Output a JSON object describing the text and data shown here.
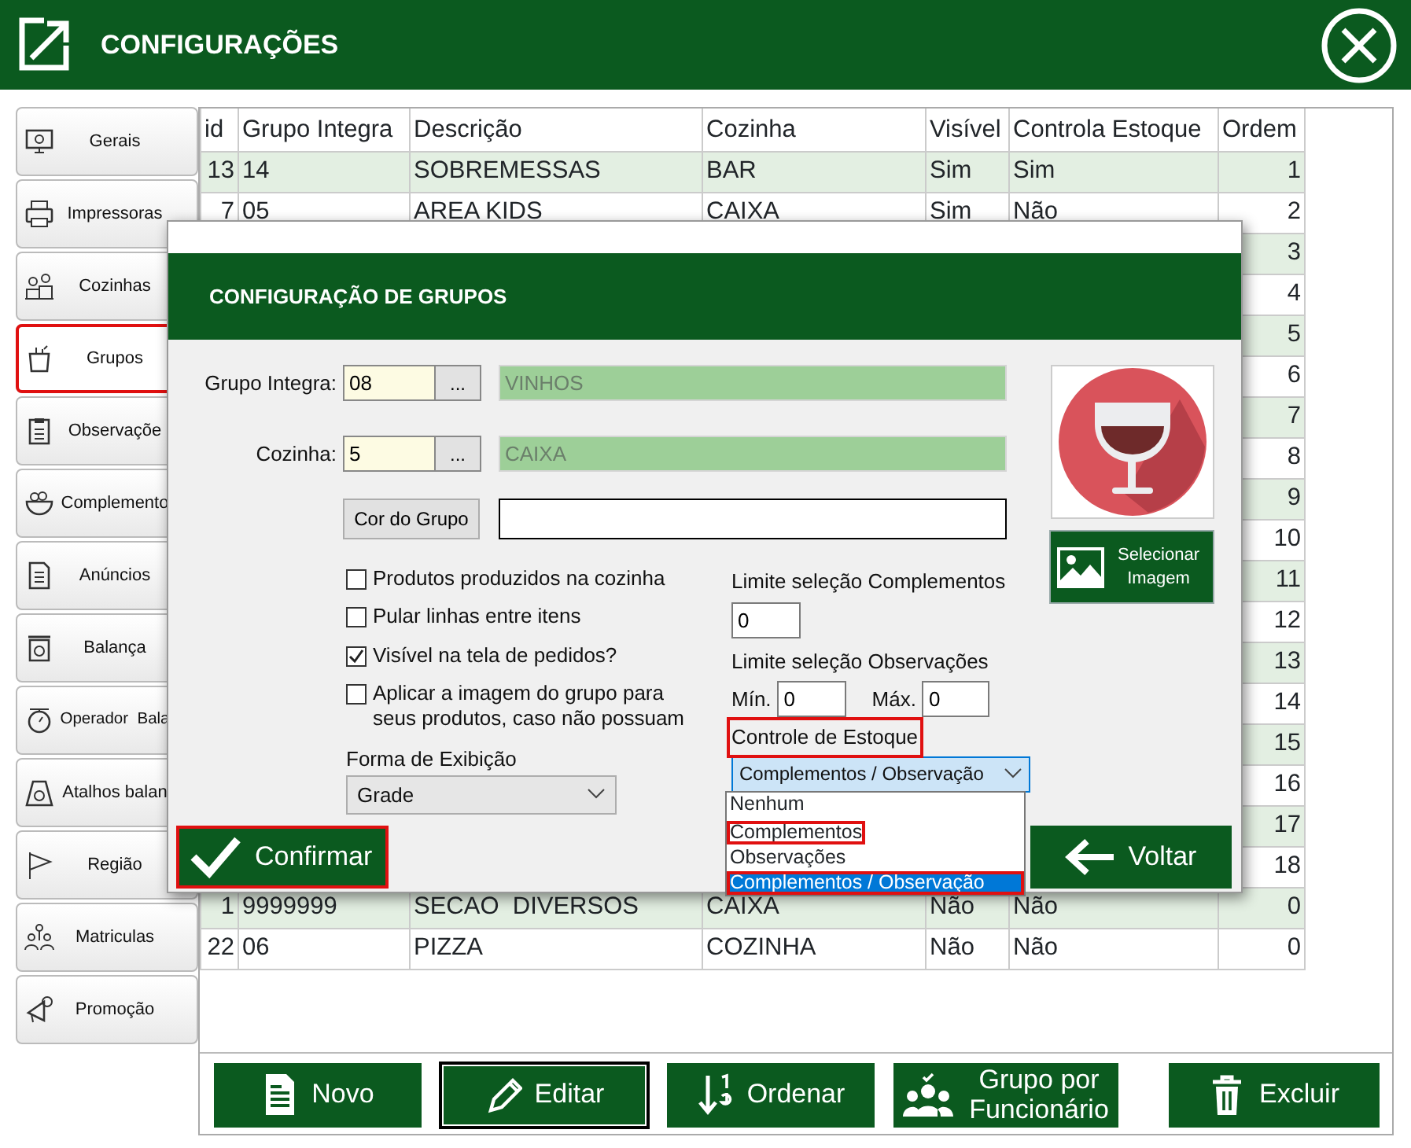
{
  "header": {
    "title": "CONFIGURAÇÕES"
  },
  "sidebar": {
    "items": [
      {
        "label": "Gerais",
        "selected": false,
        "highlighted": false
      },
      {
        "label": "Impressoras",
        "selected": false,
        "highlighted": false
      },
      {
        "label": "Cozinhas",
        "selected": false,
        "highlighted": false
      },
      {
        "label": "Grupos",
        "selected": true,
        "highlighted": true
      },
      {
        "label": "Observaçõe",
        "selected": false,
        "highlighted": false
      },
      {
        "label": "Complemento",
        "selected": false,
        "highlighted": false
      },
      {
        "label": "Anúncios",
        "selected": false,
        "highlighted": false
      },
      {
        "label": "Balança",
        "selected": false,
        "highlighted": false
      },
      {
        "label": "Operador  Bala",
        "selected": false,
        "highlighted": false
      },
      {
        "label": "Atalhos balan",
        "selected": false,
        "highlighted": false
      },
      {
        "label": "Região",
        "selected": false,
        "highlighted": false
      },
      {
        "label": "Matriculas",
        "selected": false,
        "highlighted": false
      },
      {
        "label": "Promoção",
        "selected": false,
        "highlighted": false
      }
    ]
  },
  "table": {
    "columns": [
      "id",
      "Grupo Integra",
      "Descrição",
      "Cozinha",
      "Visível",
      "Controla Estoque",
      "Ordem"
    ],
    "rows": [
      {
        "id": "13",
        "grupo": "14",
        "descricao": "SOBREMESSAS",
        "cozinha": "BAR",
        "visivel": "Sim",
        "controla": "Sim",
        "ordem": "1"
      },
      {
        "id": "7",
        "grupo": "05",
        "descricao": "AREA KIDS",
        "cozinha": "CAIXA",
        "visivel": "Sim",
        "controla": "Não",
        "ordem": "2"
      },
      {
        "ordem": "3"
      },
      {
        "ordem": "4"
      },
      {
        "ordem": "5"
      },
      {
        "ordem": "6"
      },
      {
        "ordem": "7"
      },
      {
        "ordem": "8"
      },
      {
        "ordem": "9"
      },
      {
        "ordem": "10"
      },
      {
        "ordem": "11"
      },
      {
        "ordem": "12"
      },
      {
        "ordem": "13"
      },
      {
        "ordem": "14"
      },
      {
        "ordem": "15"
      },
      {
        "ordem": "16"
      },
      {
        "ordem": "17"
      },
      {
        "ordem": "18"
      },
      {
        "id": "1",
        "grupo": "9999999",
        "descricao": "SECAO  DIVERSOS",
        "cozinha": "CAIXA",
        "visivel": "Não",
        "controla": "Não",
        "ordem": "0"
      },
      {
        "id": "22",
        "grupo": "06",
        "descricao": "PIZZA",
        "cozinha": "COZINHA",
        "visivel": "Não",
        "controla": "Não",
        "ordem": "0"
      }
    ]
  },
  "toolbar": {
    "buttons": [
      {
        "label": "Novo",
        "selected": false
      },
      {
        "label": "Editar",
        "selected": true
      },
      {
        "label": "Ordenar",
        "selected": false
      },
      {
        "label": "Grupo por Funcionário",
        "selected": false
      },
      {
        "label": "Excluir",
        "selected": false
      }
    ]
  },
  "dialog": {
    "title": "CONFIGURAÇÃO DE GRUPOS",
    "lookups": [
      {
        "label": "Grupo Integra:",
        "value": "08",
        "button": "...",
        "description": "VINHOS"
      },
      {
        "label": "Cozinha:",
        "value": "5",
        "button": "...",
        "description": "CAIXA"
      }
    ],
    "color_button": "Cor do Grupo",
    "checkboxes": [
      {
        "label": "Produtos produzidos na cozinha",
        "checked": false
      },
      {
        "label": "Pular linhas entre itens",
        "checked": false
      },
      {
        "label": "Visível na tela de pedidos?",
        "checked": true
      },
      {
        "label": "Aplicar a imagem do grupo para seus produtos, caso não possuam",
        "checked": false
      }
    ],
    "display": {
      "label": "Forma de Exibição",
      "value": "Grade"
    },
    "limit_complements": {
      "label": "Limite seleção Complementos",
      "value": "0"
    },
    "limit_observations": {
      "label": "Limite seleção Observações",
      "min_label": "Mín.",
      "min": "0",
      "max_label": "Máx.",
      "max": "0"
    },
    "stock_control": {
      "label": "Controle de Estoque",
      "highlighted": true,
      "value": "Complementos / Observação",
      "options": [
        {
          "label": "Nenhum",
          "selected": false,
          "highlighted": false
        },
        {
          "label": "Complementos",
          "selected": false,
          "highlighted": true
        },
        {
          "label": "Observações",
          "selected": false,
          "highlighted": false
        },
        {
          "label": "Complementos / Observação",
          "selected": true,
          "highlighted": true
        }
      ]
    },
    "image_button": "Selecionar Imagem",
    "confirm": {
      "label": "Confirmar",
      "highlighted": true
    },
    "back": {
      "label": "Voltar"
    }
  }
}
